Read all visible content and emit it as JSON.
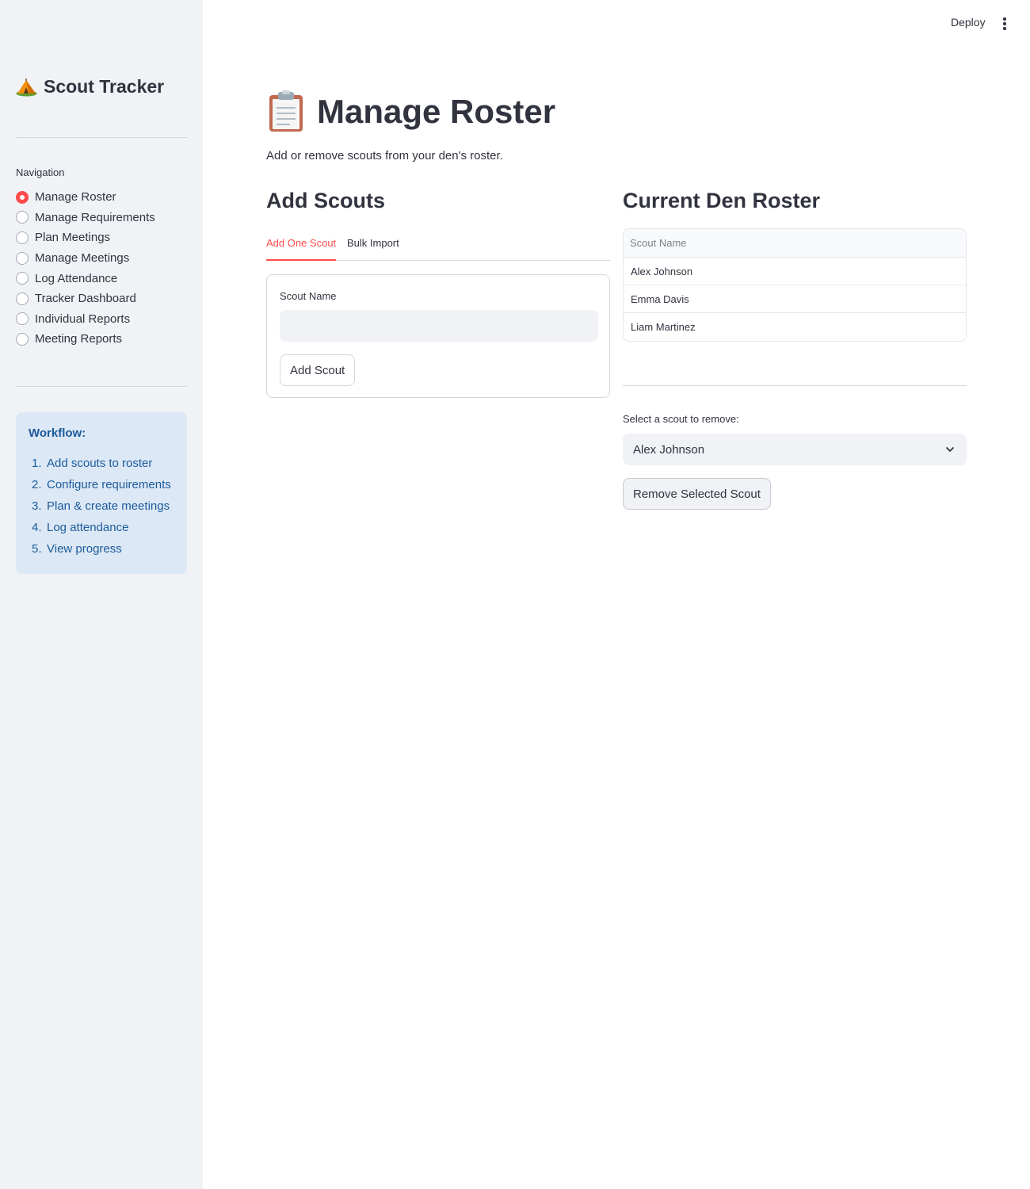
{
  "sidebar": {
    "app_title": "Scout Tracker",
    "nav_label": "Navigation",
    "nav_items": [
      {
        "label": "Manage Roster",
        "selected": true
      },
      {
        "label": "Manage Requirements",
        "selected": false
      },
      {
        "label": "Plan Meetings",
        "selected": false
      },
      {
        "label": "Manage Meetings",
        "selected": false
      },
      {
        "label": "Log Attendance",
        "selected": false
      },
      {
        "label": "Tracker Dashboard",
        "selected": false
      },
      {
        "label": "Individual Reports",
        "selected": false
      },
      {
        "label": "Meeting Reports",
        "selected": false
      }
    ],
    "workflow": {
      "title": "Workflow:",
      "steps": [
        {
          "num": "1.",
          "text": "Add scouts to roster"
        },
        {
          "num": "2.",
          "text": "Configure requirements"
        },
        {
          "num": "3.",
          "text": "Plan & create meetings"
        },
        {
          "num": "4.",
          "text": "Log attendance"
        },
        {
          "num": "5.",
          "text": "View progress"
        }
      ]
    }
  },
  "header": {
    "deploy_label": "Deploy",
    "menu_icon": "kebab-menu-icon"
  },
  "main": {
    "title": "Manage Roster",
    "title_icon": "clipboard-icon",
    "subtitle": "Add or remove scouts from your den's roster.",
    "add_section": {
      "heading": "Add Scouts",
      "tabs": [
        {
          "label": "Add One Scout",
          "active": true
        },
        {
          "label": "Bulk Import",
          "active": false
        }
      ],
      "field_label": "Scout Name",
      "field_value": "",
      "field_placeholder": "",
      "add_button": "Add Scout"
    },
    "roster_section": {
      "heading": "Current Den Roster",
      "table": {
        "columns": [
          "Scout Name"
        ],
        "rows": [
          "Alex Johnson",
          "Emma Davis",
          "Liam Martinez"
        ]
      },
      "select_label": "Select a scout to remove:",
      "selected_scout": "Alex Johnson",
      "remove_button": "Remove Selected Scout"
    }
  },
  "colors": {
    "accent": "#ff4b4b",
    "sidebar_bg": "#f0f2f6",
    "workflow_bg": "#dce8f5",
    "workflow_text": "#1c5b9c",
    "text": "#31333f"
  }
}
